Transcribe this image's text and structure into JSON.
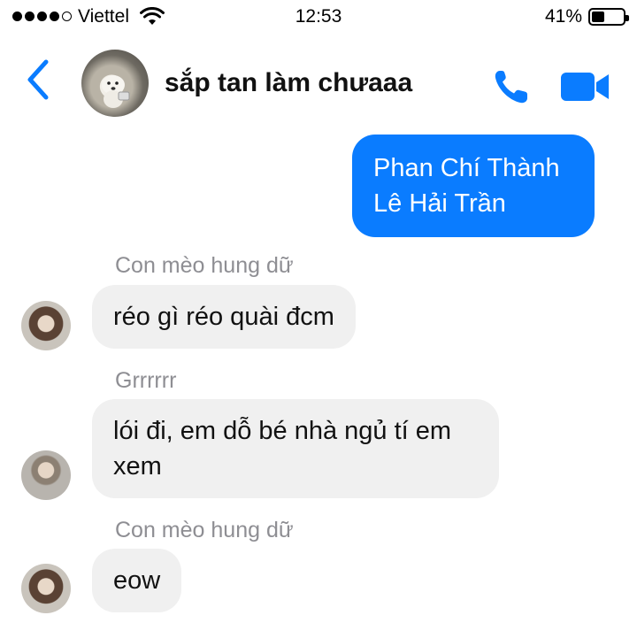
{
  "status_bar": {
    "carrier": "Viettel",
    "time": "12:53",
    "battery_percent": "41%",
    "battery_level": 0.41,
    "signal_bars_filled": 4,
    "signal_bars_total": 5
  },
  "header": {
    "title": "sắp tan làm chưaaa",
    "icons": {
      "back": "back-chevron-icon",
      "call": "phone-icon",
      "video": "video-camera-icon"
    },
    "accent_color": "#0a7cff"
  },
  "messages": {
    "outgoing": {
      "lines": [
        "Phan Chí Thành",
        "Lê Hải Trần"
      ]
    },
    "incoming": [
      {
        "sender": "Con mèo hung dữ",
        "text": "réo gì réo quài đcm"
      },
      {
        "sender": "Grrrrrr",
        "text_lines": [
          "lói đi, em dỗ bé nhà ngủ tí em",
          "xem"
        ]
      },
      {
        "sender": "Con mèo hung dữ",
        "text": "eow"
      }
    ]
  }
}
